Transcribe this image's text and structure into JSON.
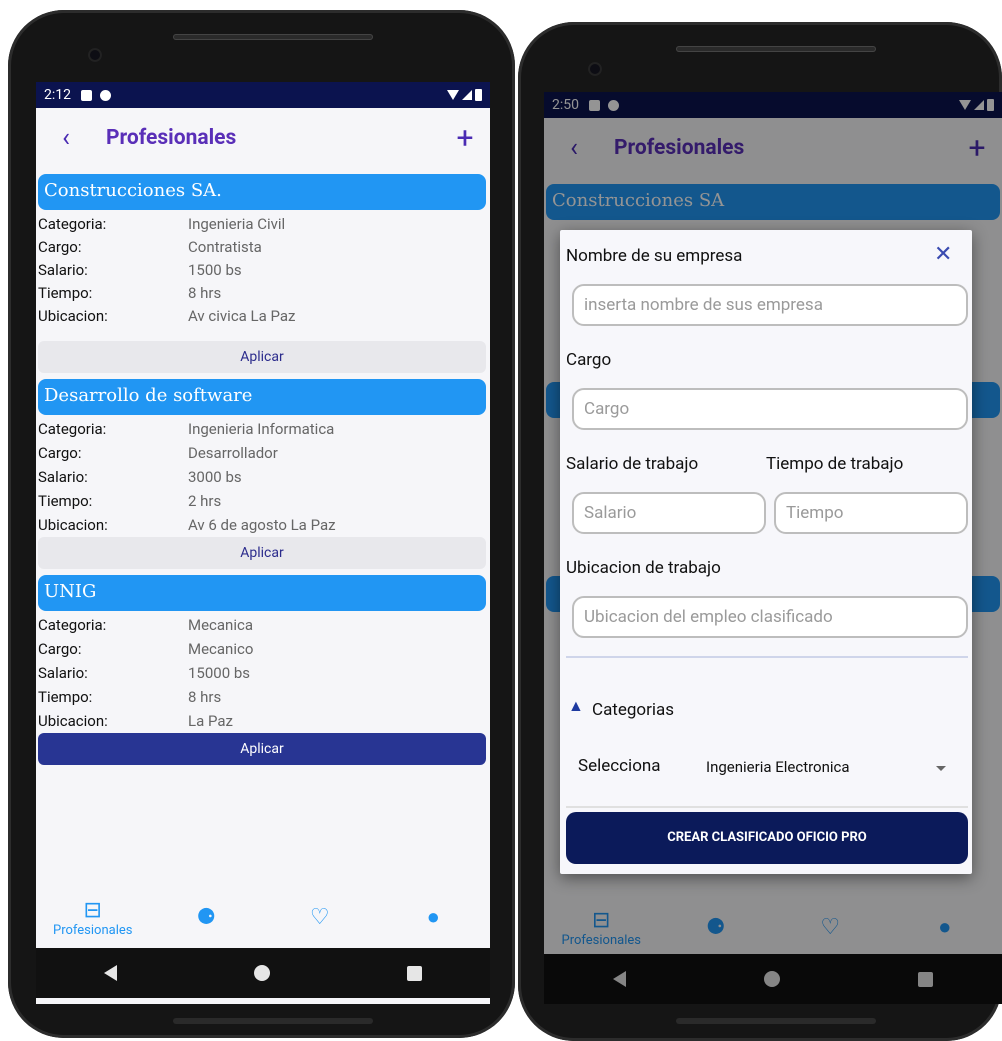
{
  "left": {
    "status_time": "2:12",
    "title": "Profesionales",
    "back_glyph": "‹",
    "add_glyph": "+",
    "labels": {
      "categoria": "Categoria:",
      "cargo": "Cargo:",
      "salario": "Salario:",
      "tiempo": "Tiempo:",
      "ubicacion": "Ubicacion:"
    },
    "apply_label": "Aplicar",
    "cards": [
      {
        "company": "Construcciones SA.",
        "categoria": "Ingenieria Civil",
        "cargo": "Contratista",
        "salario": "1500 bs",
        "tiempo": " 8 hrs",
        "ubicacion": "Av civica La Paz"
      },
      {
        "company": "Desarrollo de software",
        "categoria": "Ingenieria Informatica",
        "cargo": "Desarrollador",
        "salario": "3000 bs",
        "tiempo": "2 hrs",
        "ubicacion": "Av 6 de agosto La Paz"
      },
      {
        "company": "UNIG",
        "categoria": "Mecanica",
        "cargo": "Mecanico",
        "salario": "15000 bs",
        "tiempo": "8 hrs",
        "ubicacion": "La Paz"
      }
    ],
    "nav": {
      "profesionales": "Profesionales"
    }
  },
  "right": {
    "status_time": "2:50",
    "title": "Profesionales",
    "bg_company": "Construcciones SA",
    "dialog": {
      "company_label": "Nombre de su empresa",
      "company_placeholder": "inserta nombre de sus empresa",
      "cargo_label": "Cargo",
      "cargo_placeholder": "Cargo",
      "salario_label": "Salario de trabajo",
      "tiempo_label": "Tiempo de trabajo",
      "salario_placeholder": "Salario",
      "tiempo_placeholder": "Tiempo",
      "ubicacion_label": "Ubicacion de trabajo",
      "ubicacion_placeholder": "Ubicacion del empleo clasificado",
      "categorias_label": "Categorias",
      "selecciona_label": "Selecciona",
      "selected_category": "Ingenieria Electronica",
      "create_button": "CREAR CLASIFICADO OFICIO PRO",
      "close_glyph": "✕"
    },
    "nav": {
      "profesionales": "Profesionales"
    }
  },
  "colors": {
    "accent": "#2196f3",
    "title": "#5a2fb8",
    "status_bar": "#0b134f",
    "active_button": "#283593",
    "create_button": "#0b1a5a"
  }
}
